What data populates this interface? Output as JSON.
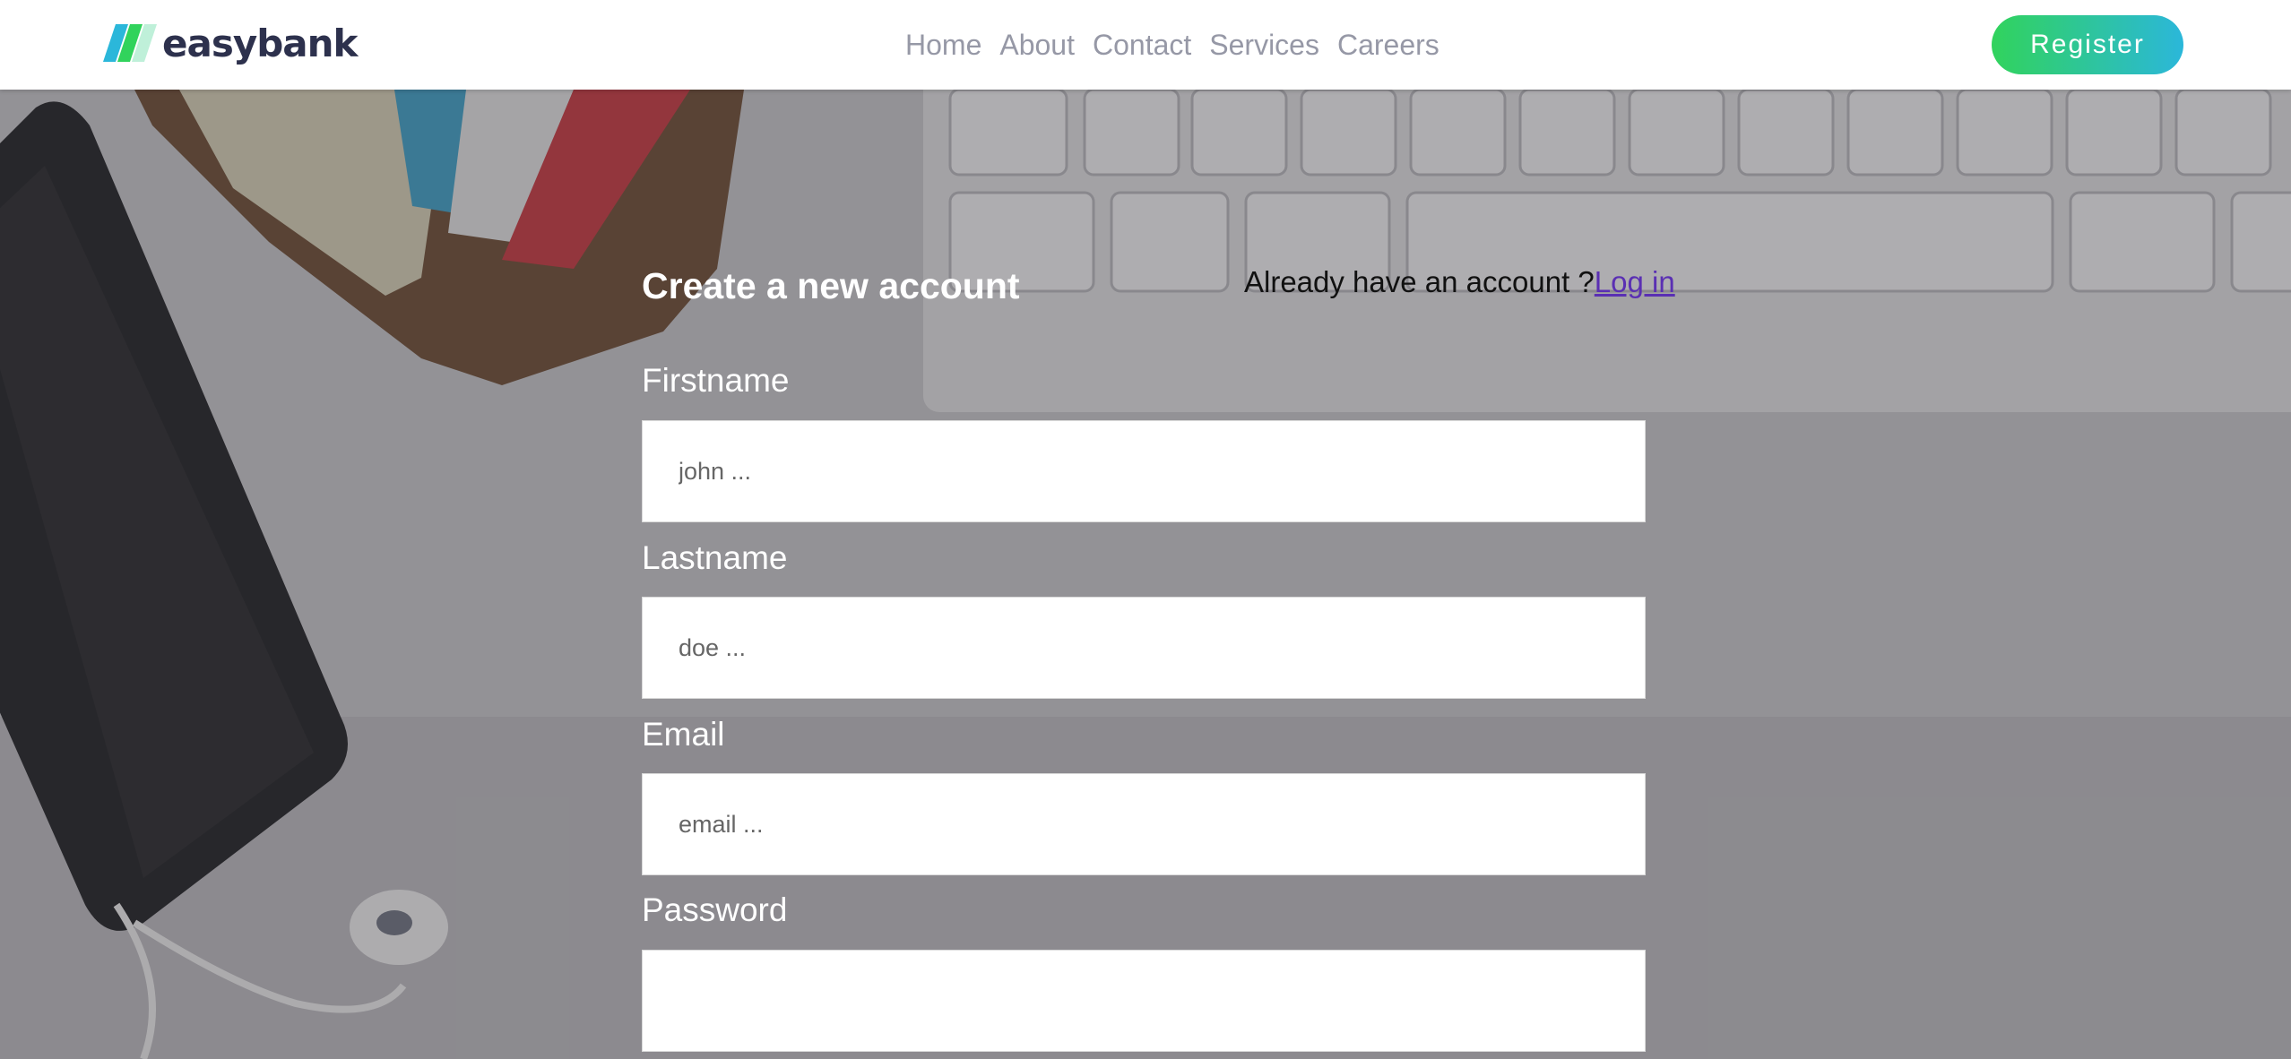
{
  "brand": {
    "name": "easybank",
    "colors": {
      "navy": "#2d314d",
      "green": "#31d35c",
      "cyan": "#2bb7da",
      "nav_text": "#9698a6"
    }
  },
  "nav": {
    "links": [
      {
        "label": "Home"
      },
      {
        "label": "About"
      },
      {
        "label": "Contact"
      },
      {
        "label": "Services"
      },
      {
        "label": "Careers"
      }
    ]
  },
  "header": {
    "register_label": "Register"
  },
  "form": {
    "title": "Create a new account",
    "login_prompt": "Already have an account ?",
    "login_link": "Log in",
    "fields": [
      {
        "label": "Firstname",
        "placeholder": "john ...",
        "value": ""
      },
      {
        "label": "Lastname",
        "placeholder": "doe ...",
        "value": ""
      },
      {
        "label": "Email",
        "placeholder": "email ...",
        "value": ""
      },
      {
        "label": "Password",
        "placeholder": "",
        "value": ""
      }
    ]
  },
  "background": {
    "image": "desk-photo: smartphone, wallet with cards, keyboard, earphones"
  }
}
